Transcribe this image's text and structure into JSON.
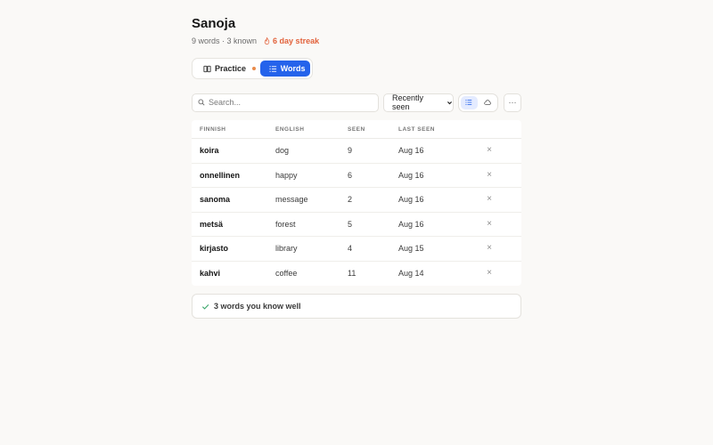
{
  "header": {
    "title": "Sanoja",
    "word_count": "9 words · 3 known",
    "streak": "6 day streak",
    "streak_icon": "flame-icon",
    "streak_color": "#e2623b"
  },
  "tabs": [
    {
      "label": "Practice",
      "icon": "book-icon",
      "active": false,
      "has_dot": true
    },
    {
      "label": "Words",
      "icon": "list-icon",
      "active": true
    }
  ],
  "accent_color": "#2563eb",
  "toolbar": {
    "search_placeholder": "Search...",
    "sort_value": "Recently seen",
    "view_modes": [
      "list-icon",
      "cloud-icon"
    ],
    "active_view": "list",
    "more_label": "···"
  },
  "table": {
    "columns": [
      "FINNISH",
      "ENGLISH",
      "SEEN",
      "LAST SEEN"
    ],
    "rows": [
      {
        "finnish": "koira",
        "english": "dog",
        "seen": "9",
        "last_seen": "Aug 16"
      },
      {
        "finnish": "onnellinen",
        "english": "happy",
        "seen": "6",
        "last_seen": "Aug 16"
      },
      {
        "finnish": "sanoma",
        "english": "message",
        "seen": "2",
        "last_seen": "Aug 16"
      },
      {
        "finnish": "metsä",
        "english": "forest",
        "seen": "5",
        "last_seen": "Aug 16"
      },
      {
        "finnish": "kirjasto",
        "english": "library",
        "seen": "4",
        "last_seen": "Aug 15"
      },
      {
        "finnish": "kahvi",
        "english": "coffee",
        "seen": "11",
        "last_seen": "Aug 14"
      }
    ],
    "delete_glyph": "×"
  },
  "known_section": {
    "label": "3 words you know well",
    "icon": "check-icon",
    "icon_color": "#3aa66a"
  }
}
